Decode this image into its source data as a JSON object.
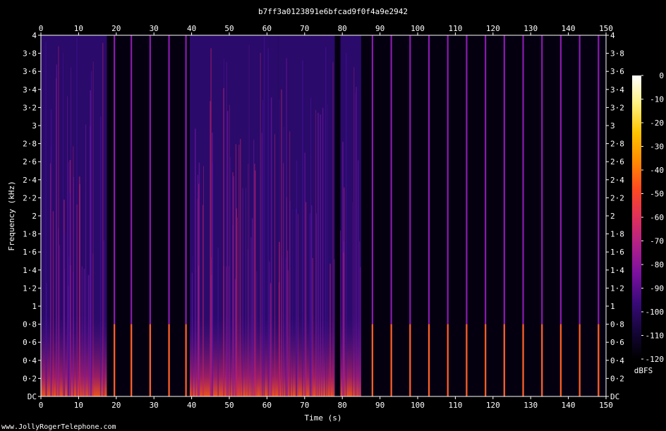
{
  "chart_data": {
    "type": "heatmap",
    "title": "b7ff3a0123891e6bfcad9f0f4a9e2942",
    "xlabel": "Time (s)",
    "ylabel": "Frequency (kHz)",
    "xlim": [
      0,
      150
    ],
    "ylim": [
      0,
      4
    ],
    "x_ticks": [
      "0",
      "10",
      "20",
      "30",
      "40",
      "50",
      "60",
      "70",
      "80",
      "90",
      "100",
      "110",
      "120",
      "130",
      "140",
      "150"
    ],
    "y_ticks": [
      "DC",
      "0·2",
      "0·4",
      "0·6",
      "0·8",
      "1",
      "1·2",
      "1·4",
      "1·6",
      "1·8",
      "2",
      "2·2",
      "2·4",
      "2·6",
      "2·8",
      "3",
      "3·2",
      "3·4",
      "3·6",
      "3·8",
      "4"
    ],
    "colorbar": {
      "label": "dBFS",
      "range": [
        -120,
        0
      ],
      "ticks": [
        "0",
        "-10",
        "-20",
        "-30",
        "-40",
        "-50",
        "-60",
        "-70",
        "-80",
        "-90",
        "-100",
        "-110",
        "-120"
      ],
      "colors": [
        "#000000",
        "#16063a",
        "#3a0a7a",
        "#7a10a0",
        "#b0208a",
        "#e0305a",
        "#ff4a20",
        "#ff8c00",
        "#ffc400",
        "#fff080",
        "#ffffff"
      ]
    },
    "segments": [
      {
        "x": [
          0,
          17.5
        ],
        "description": "dense broadband speech, energy up to 4 kHz, strong low band"
      },
      {
        "x": [
          39.5,
          63
        ],
        "description": "dense broadband speech"
      },
      {
        "x": [
          63,
          78
        ],
        "description": "speech with moderate energy"
      },
      {
        "x": [
          79.5,
          85
        ],
        "description": "speech with moderate energy"
      }
    ],
    "pulse_times": [
      19.5,
      24,
      29,
      34,
      38.5,
      88,
      93,
      98,
      103,
      108,
      113,
      118,
      123,
      128,
      133,
      138,
      143,
      148
    ]
  },
  "watermark": "www.JollyRogerTelephone.com"
}
